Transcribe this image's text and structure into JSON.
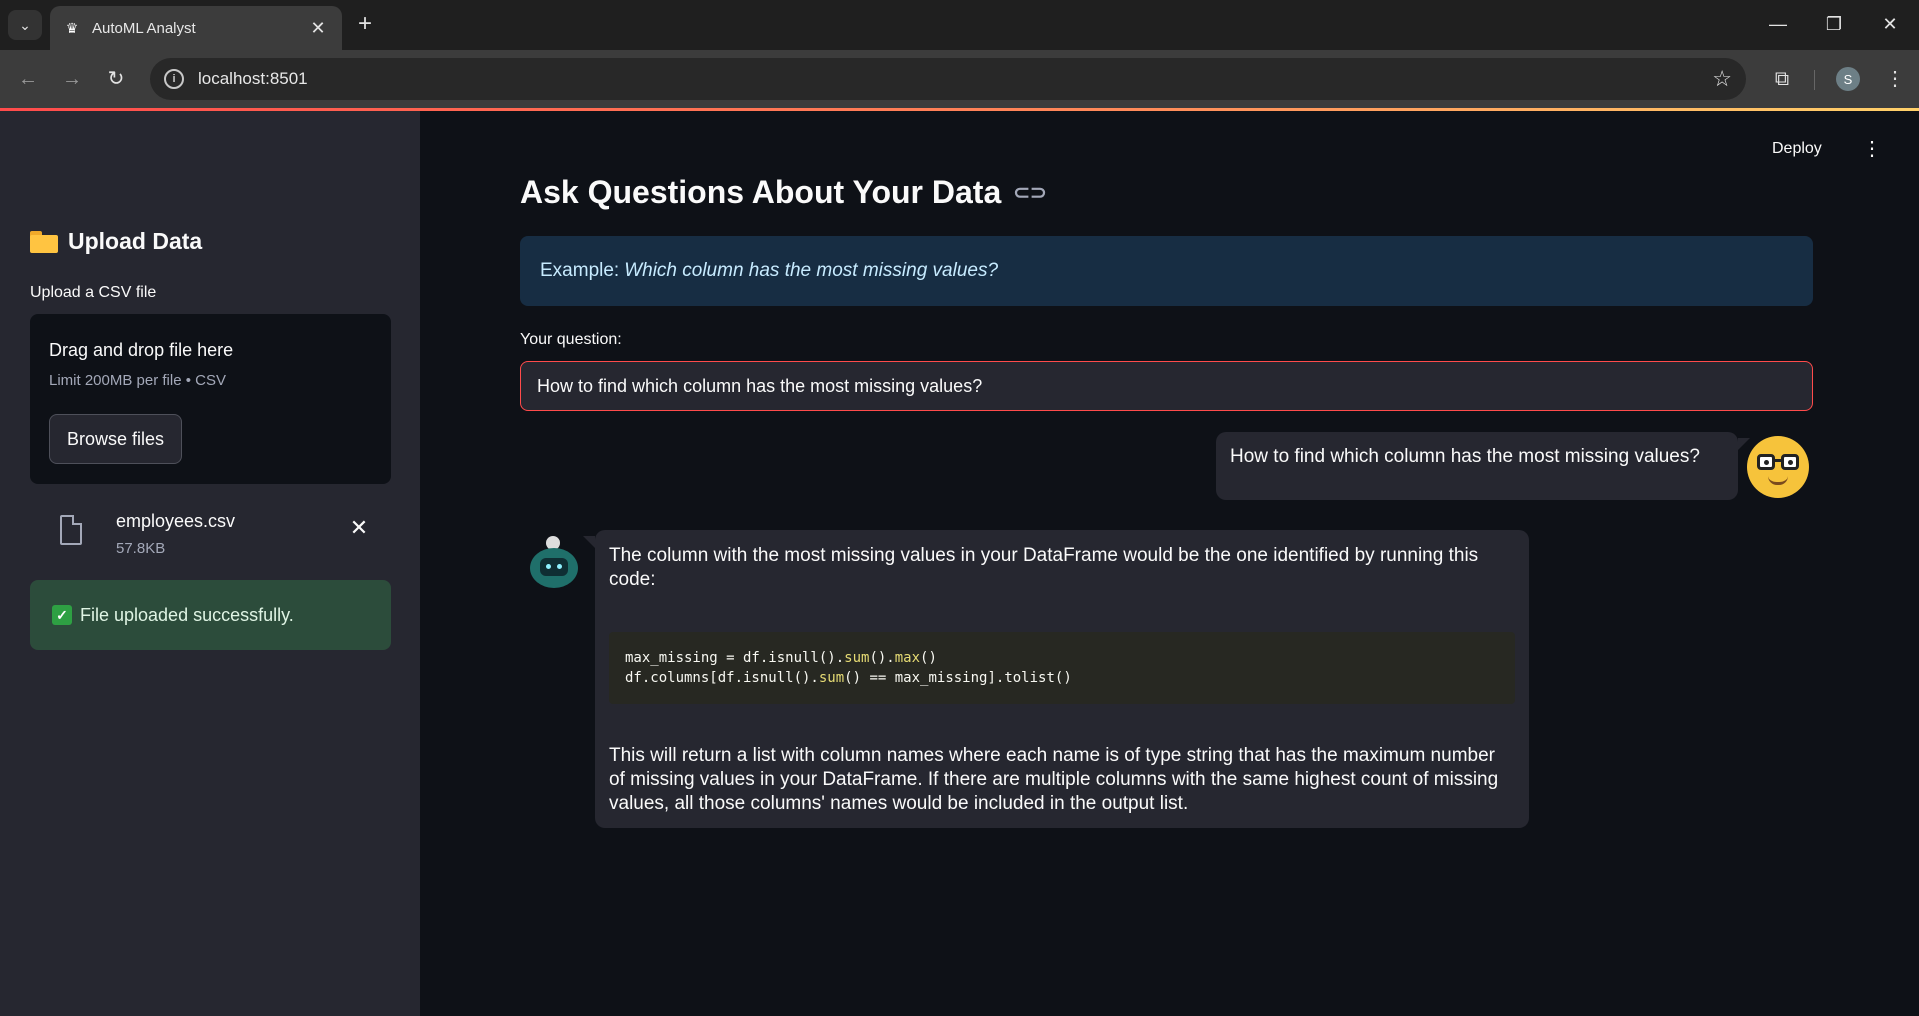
{
  "browser": {
    "tab_title": "AutoML Analyst",
    "url": "localhost:8501",
    "profile_initial": "S"
  },
  "icons": {
    "tab_search": "chevron-down-icon",
    "favicon": "streamlit-crown-icon",
    "info": "site-info-icon",
    "bookmark": "star-icon",
    "extensions": "puzzle-icon",
    "link": "link-icon"
  },
  "sidebar": {
    "header": "Upload Data",
    "upload_label": "Upload a CSV file",
    "dropzone_title": "Drag and drop file here",
    "dropzone_limit": "Limit 200MB per file • CSV",
    "browse_button": "Browse files",
    "file": {
      "name": "employees.csv",
      "size": "57.8KB"
    },
    "success_message": "File uploaded successfully."
  },
  "main": {
    "deploy_label": "Deploy",
    "title": "Ask Questions About Your Data",
    "example_prefix": "Example:",
    "example_text": "Which column has the most missing values?",
    "question_label": "Your question:",
    "question_value": "How to find which column has the most missing values?"
  },
  "chat": {
    "user_message": "How to find which column has the most missing values?",
    "bot_intro": "The column with the most missing values in your DataFrame would be the one identified by running this code:",
    "code_line1": {
      "a": "max_missing = df.isnull().",
      "fn1": "sum",
      "b": "().",
      "fn2": "max",
      "c": "()"
    },
    "code_line2": {
      "a": "df.columns[df.isnull().",
      "fn1": "sum",
      "b": "() == max_missing].tolist()"
    },
    "bot_outro": "This will return a list with column names where each name is of type string that has the maximum number of missing values in your DataFrame. If there are multiple columns with the same highest count of missing values, all those columns' names would be included in the output list."
  },
  "colors": {
    "accent": "#ff4b4b",
    "sidebar_bg": "#262730",
    "main_bg": "#0e1117",
    "info_bg": "#172d43",
    "success_bg": "#2c4c3b"
  }
}
